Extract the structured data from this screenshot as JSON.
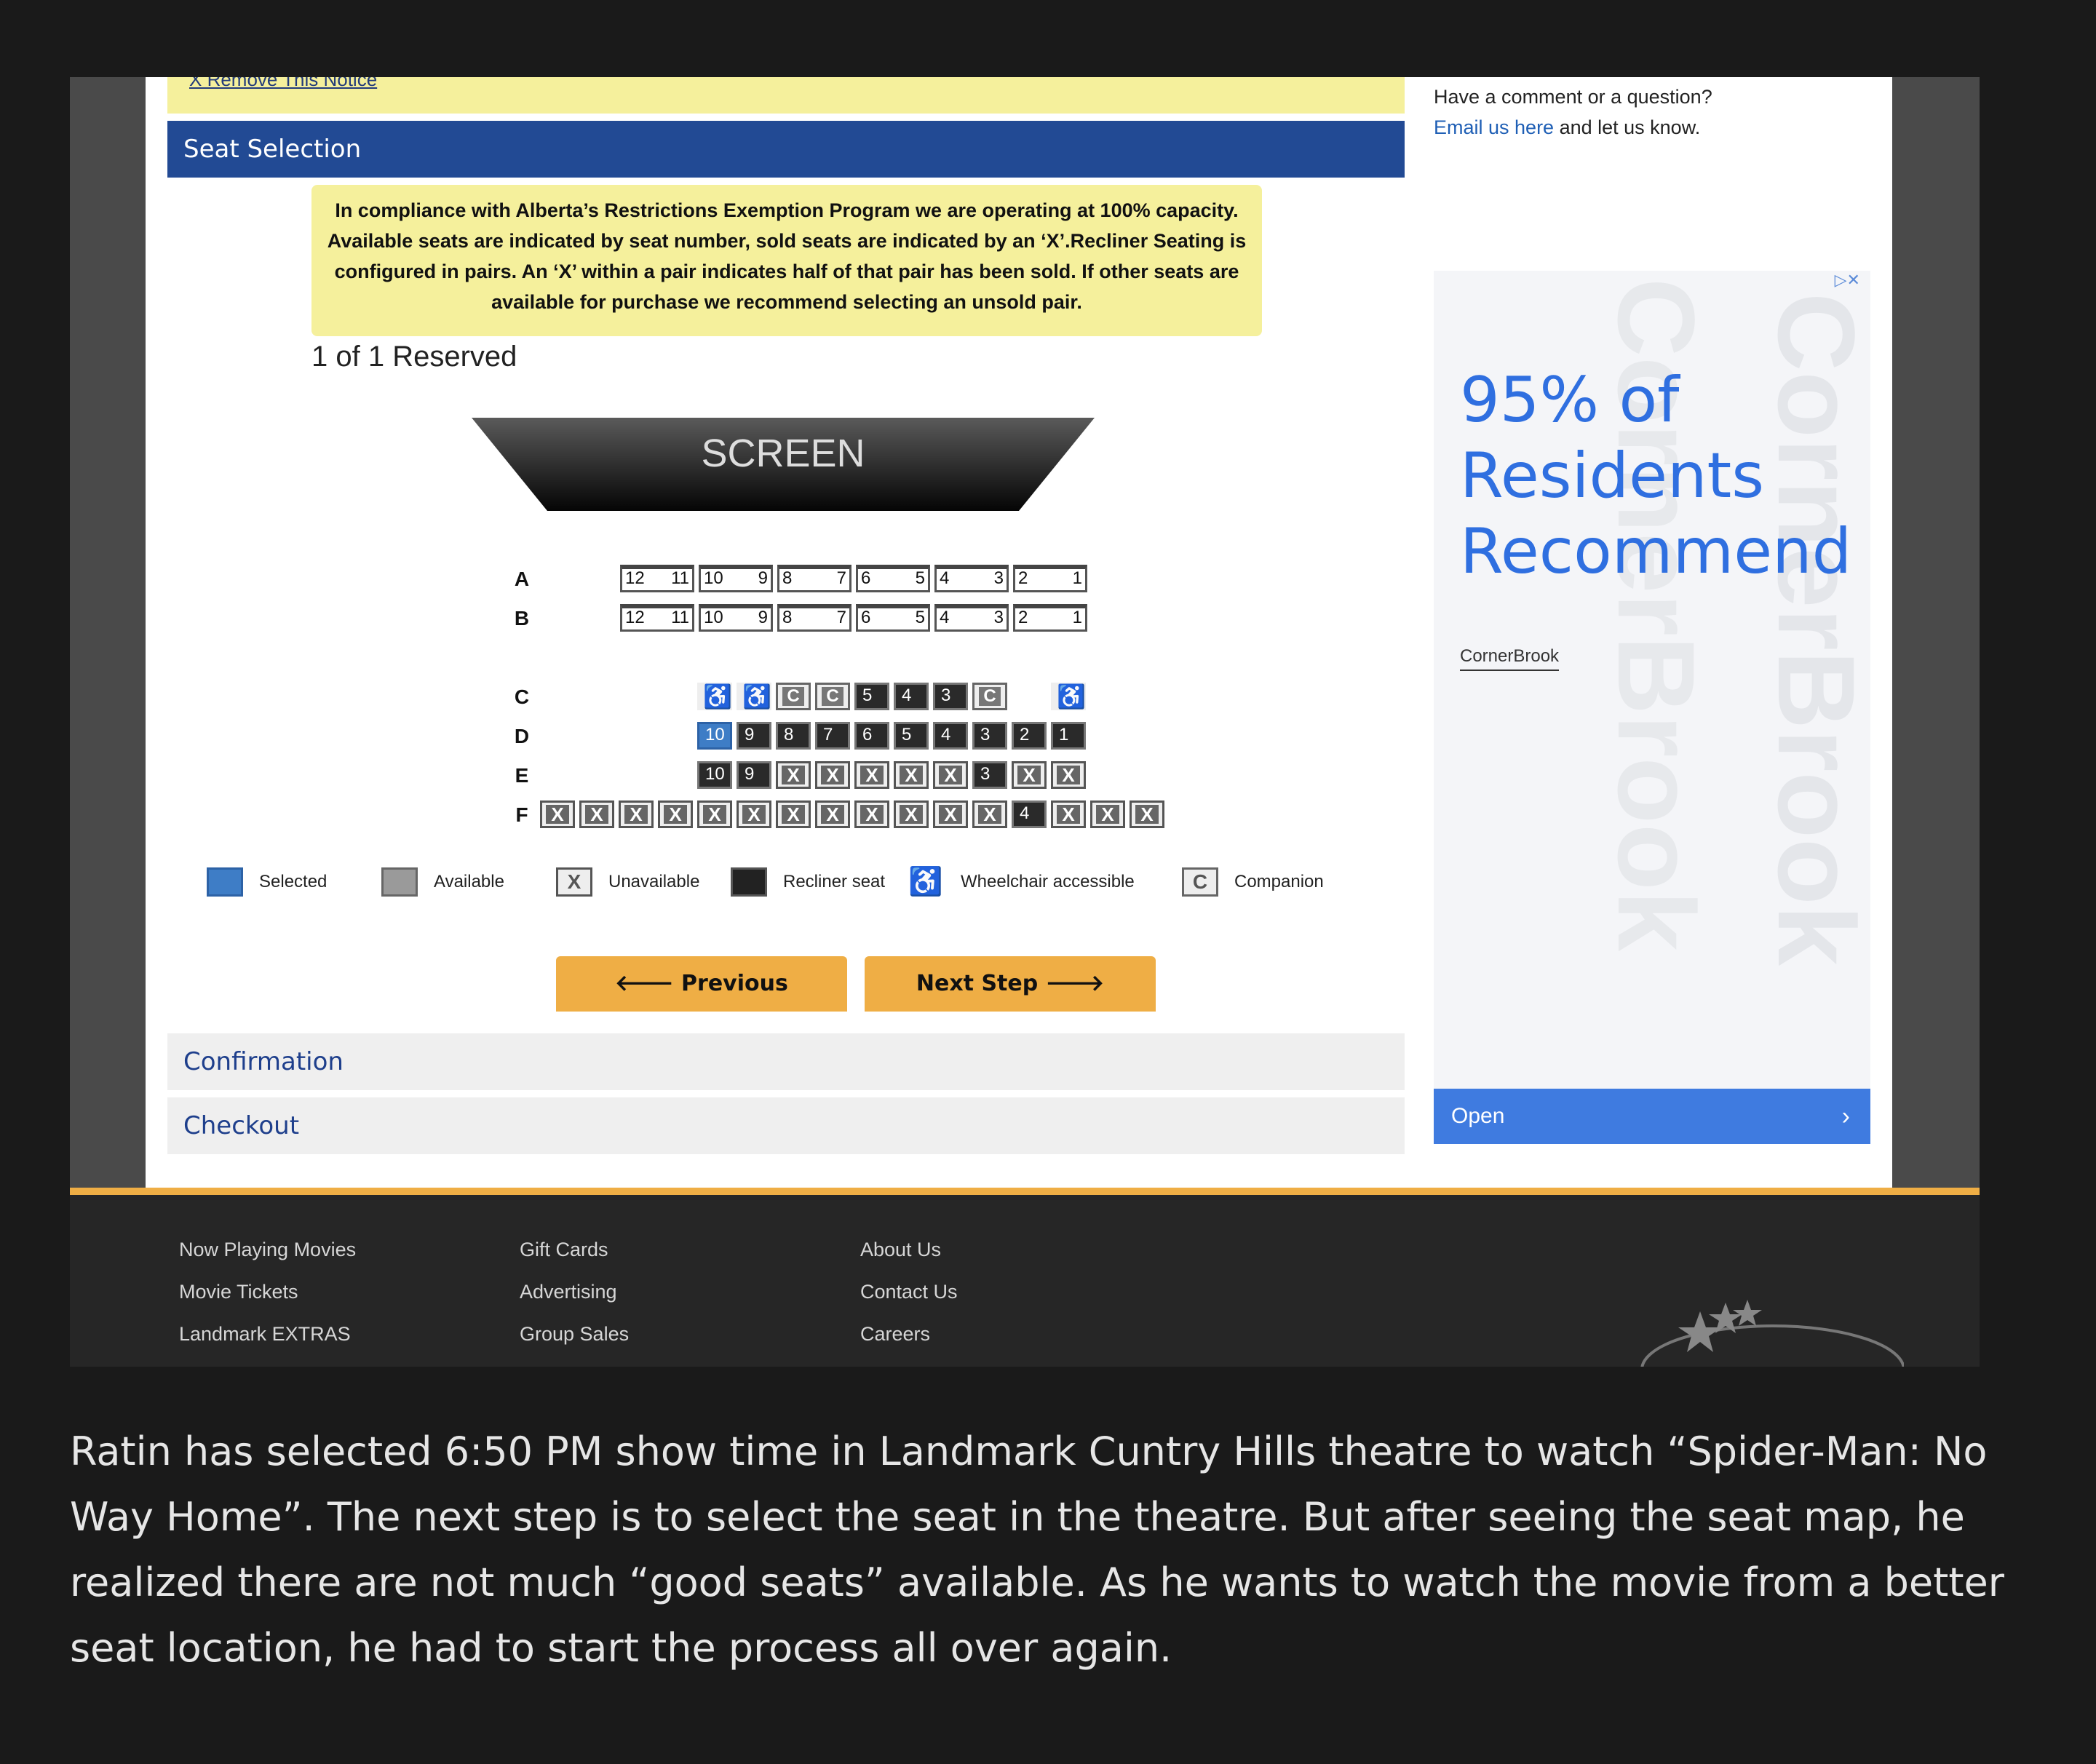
{
  "notice": {
    "remove_link": "X Remove This Notice"
  },
  "section": {
    "title": "Seat Selection"
  },
  "info_text": "In compliance with Alberta’s Restrictions Exemption Program we are operating at 100% capacity. Available seats are indicated by seat number, sold seats are indicated by an ‘X’.Recliner Seating is configured in pairs. An ‘X’ within a pair indicates half of that pair has been sold. If other seats are available for purchase we recommend selecting an unsold pair.",
  "reserved_count": "1 of 1 Reserved",
  "screen_label": "SCREEN",
  "rows": [
    {
      "label": "A",
      "seats": [
        {
          "type": "av",
          "a": "12",
          "b": "11"
        },
        {
          "type": "av",
          "a": "10",
          "b": "9"
        },
        {
          "type": "av",
          "a": "8",
          "b": "7"
        },
        {
          "type": "av",
          "a": "6",
          "b": "5"
        },
        {
          "type": "av",
          "a": "4",
          "b": "3"
        },
        {
          "type": "av",
          "a": "2",
          "b": "1"
        }
      ]
    },
    {
      "label": "B",
      "seats": [
        {
          "type": "av",
          "a": "12",
          "b": "11"
        },
        {
          "type": "av",
          "a": "10",
          "b": "9"
        },
        {
          "type": "av",
          "a": "8",
          "b": "7"
        },
        {
          "type": "av",
          "a": "6",
          "b": "5"
        },
        {
          "type": "av",
          "a": "4",
          "b": "3"
        },
        {
          "type": "av",
          "a": "2",
          "b": "1"
        }
      ]
    },
    {
      "label": "C",
      "seats": []
    },
    {
      "label": "D",
      "seats": []
    },
    {
      "label": "E",
      "seats": []
    },
    {
      "label": "F",
      "seats": []
    }
  ],
  "row_c": [
    "wc",
    "wc",
    "comp",
    "comp",
    "5",
    "4",
    "3",
    "comp",
    "wc"
  ],
  "row_d": [
    "10",
    "9",
    "8",
    "7",
    "6",
    "5",
    "4",
    "3",
    "2",
    "1"
  ],
  "row_e": [
    "10",
    "9",
    "X",
    "X",
    "X",
    "X",
    "X",
    "3",
    "X",
    "X"
  ],
  "row_f": [
    "X",
    "X",
    "X",
    "X",
    "X",
    "X",
    "X",
    "X",
    "X",
    "X",
    "X",
    "X",
    "4",
    "X",
    "X",
    "X"
  ],
  "seat_glyphs": {
    "unavailable": "X",
    "companion": "C",
    "wheelchair": "♿"
  },
  "legend": [
    {
      "label": "Selected"
    },
    {
      "label": "Available"
    },
    {
      "label": "Unavailable"
    },
    {
      "label": "Recliner seat"
    },
    {
      "label": "Wheelchair accessible"
    },
    {
      "label": "Companion"
    }
  ],
  "buttons": {
    "previous": "Previous",
    "next": "Next Step",
    "prev_icon": "🡐",
    "next_icon": "🡒"
  },
  "accordion": {
    "confirmation": "Confirmation",
    "checkout": "Checkout"
  },
  "sidebar": {
    "question": "Have a comment or a question?",
    "email_link": "Email us here",
    "email_tail": " and let us know."
  },
  "ad": {
    "headline_1": "95% of",
    "headline_2": "Residents",
    "headline_3": "Recommend",
    "brand": "CornerBrook",
    "watermark": "CornerBrook",
    "open_label": "Open",
    "adchoices": "▷✕",
    "chevron": "›"
  },
  "footer": {
    "col1": [
      "Now Playing Movies",
      "Movie Tickets",
      "Landmark EXTRAS"
    ],
    "col2": [
      "Gift Cards",
      "Advertising",
      "Group Sales"
    ],
    "col3": [
      "About Us",
      "Contact Us",
      "Careers"
    ]
  },
  "caption": "Ratin has selected 6:50 PM show time in Landmark Cuntry Hills theatre to watch “Spider-Man: No Way Home”.  The next step is to select the seat in the theatre. But after seeing the seat map, he realized there are not much “good seats” available. As he wants to watch the movie from a better seat location, he had to start the process  all over again.",
  "colors": {
    "header_blue": "#224a94",
    "notice_yellow": "#f5f09c",
    "button_orange": "#efae45",
    "selected_blue": "#3e7dc6",
    "ad_blue": "#3f7be0"
  }
}
